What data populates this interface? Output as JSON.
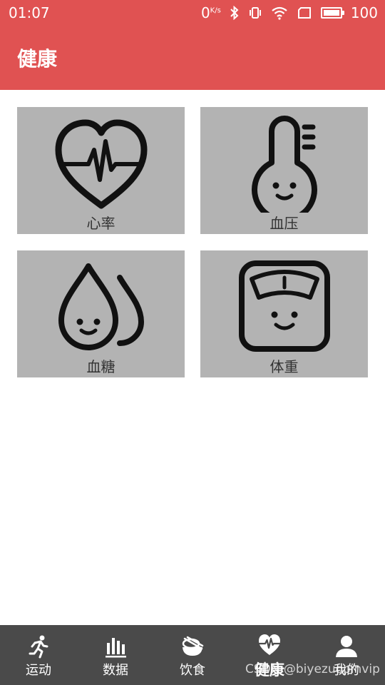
{
  "status_bar": {
    "time": "01:07",
    "net_speed": "0",
    "net_speed_unit": "K/s",
    "battery": "100",
    "battery_level": 1.0
  },
  "app_bar": {
    "title": "健康"
  },
  "tiles": [
    {
      "label": "心率",
      "icon": "heart-rate-icon"
    },
    {
      "label": "血压",
      "icon": "thermometer-icon"
    },
    {
      "label": "血糖",
      "icon": "blood-drop-icon"
    },
    {
      "label": "体重",
      "icon": "weight-scale-icon"
    }
  ],
  "bottom_nav": {
    "active_index": 3,
    "items": [
      {
        "label": "运动",
        "icon": "running-icon"
      },
      {
        "label": "数据",
        "icon": "bar-chart-icon"
      },
      {
        "label": "饮食",
        "icon": "food-bowl-icon"
      },
      {
        "label": "健康",
        "icon": "heart-pulse-icon"
      },
      {
        "label": "我的",
        "icon": "user-icon"
      }
    ]
  },
  "watermark": "CSDN @biyezuopinvip",
  "colors": {
    "accent": "#e05252",
    "tile_bg": "#b3b3b3",
    "nav_bg": "#4a4a4a"
  }
}
